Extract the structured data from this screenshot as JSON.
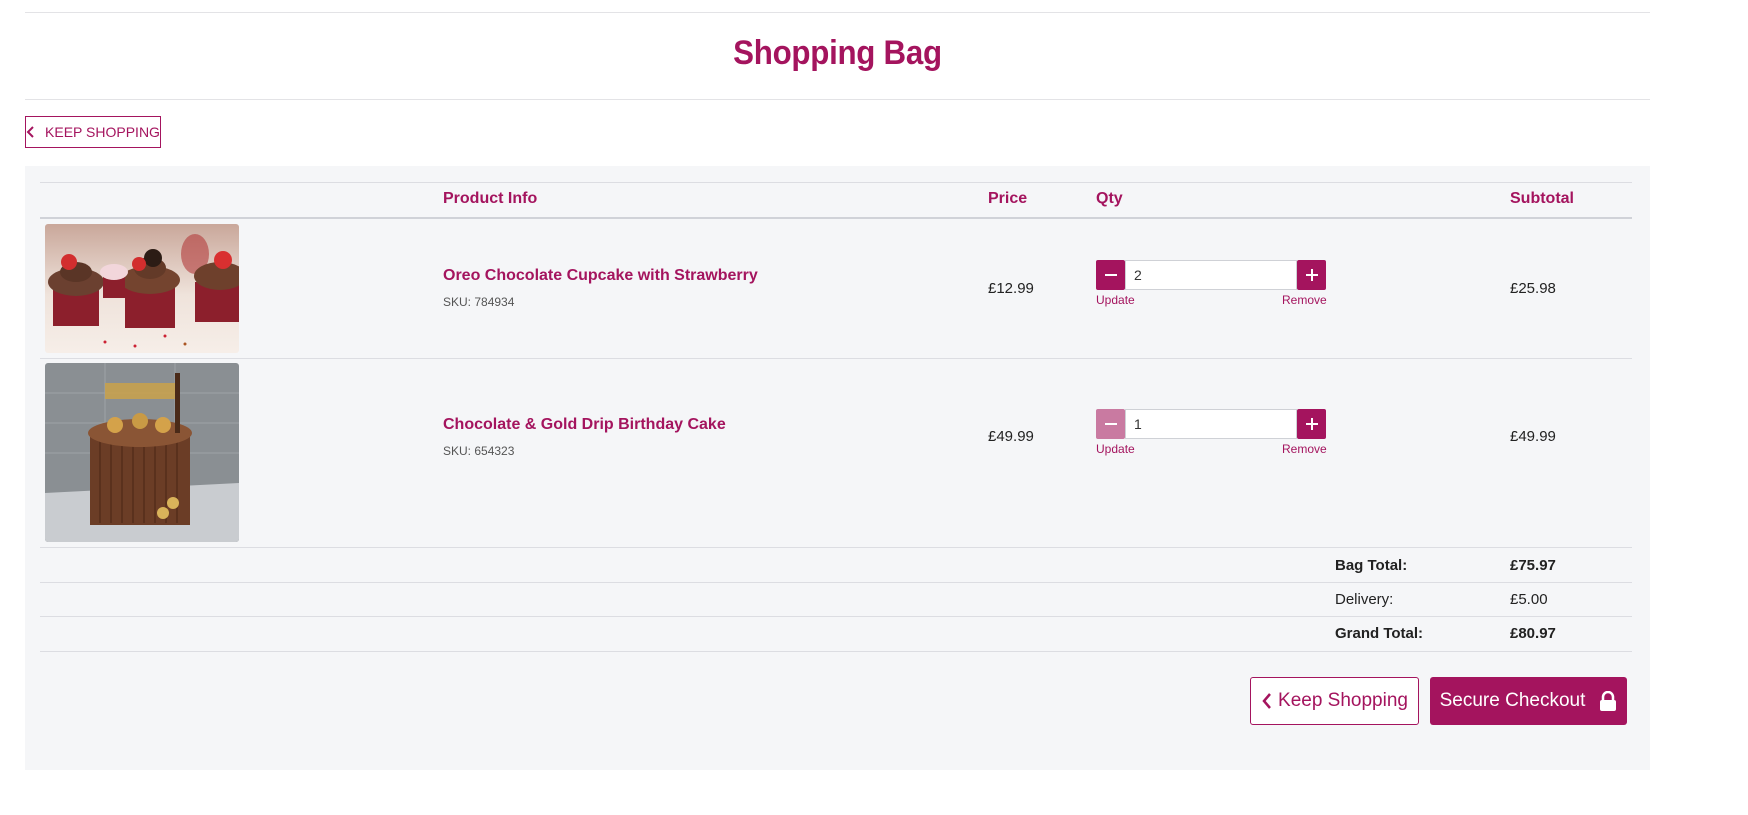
{
  "page": {
    "title": "Shopping Bag"
  },
  "top_actions": {
    "keep_shopping_label": "KEEP SHOPPING"
  },
  "table": {
    "headers": {
      "product": "Product Info",
      "price": "Price",
      "qty": "Qty",
      "subtotal": "Subtotal"
    }
  },
  "items": [
    {
      "name": "Oreo Chocolate Cupcake with Strawberry",
      "sku": "SKU: 784934",
      "price": "£12.99",
      "qty": "2",
      "update": "Update",
      "remove": "Remove",
      "subtotal": "£25.98"
    },
    {
      "name": "Chocolate & Gold Drip Birthday Cake",
      "sku": "SKU: 654323",
      "price": "£49.99",
      "qty": "1",
      "update": "Update",
      "remove": "Remove",
      "subtotal": "£49.99"
    }
  ],
  "totals": {
    "bag_total_label": "Bag Total:",
    "bag_total": "£75.97",
    "delivery_label": "Delivery:",
    "delivery": "£5.00",
    "grand_total_label": "Grand Total:",
    "grand_total": "£80.97"
  },
  "footer_actions": {
    "keep_shopping_label": "Keep Shopping",
    "checkout_label": "Secure Checkout"
  },
  "colors": {
    "accent": "#a4145e",
    "accent_disabled": "#c97aa1",
    "panel_bg": "#f5f6f8"
  },
  "icons": {
    "back": "chevron-left-icon",
    "minus": "minus-icon",
    "plus": "plus-icon",
    "lock": "lock-icon"
  }
}
